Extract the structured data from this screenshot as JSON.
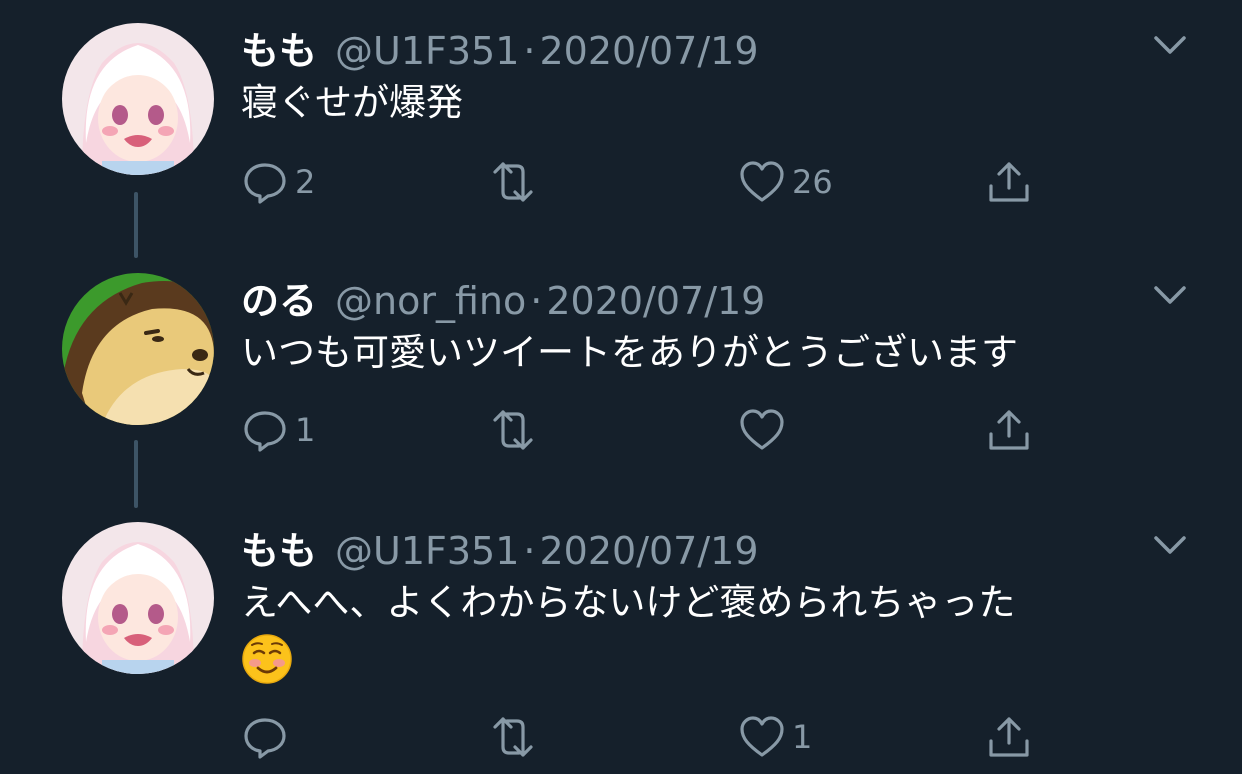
{
  "tweets": [
    {
      "name": "もも",
      "handle": "@U1F351",
      "sep": "·",
      "date": "2020/07/19",
      "text": "寝ぐせが爆発",
      "replies": "2",
      "retweets": "",
      "likes": "26",
      "avatar": "anime-girl-avatar"
    },
    {
      "name": "のる",
      "handle": "@nor_fino",
      "sep": "·",
      "date": "2020/07/19",
      "text": "いつも可愛いツイートをありがとうございます",
      "replies": "1",
      "retweets": "",
      "likes": "",
      "avatar": "hamster-avatar"
    },
    {
      "name": "もも",
      "handle": "@U1F351",
      "sep": "·",
      "date": "2020/07/19",
      "text": "えへへ、よくわからないけど褒められちゃった",
      "emoji": "smiling-face-emoji",
      "replies": "",
      "retweets": "",
      "likes": "1",
      "avatar": "anime-girl-avatar"
    }
  ],
  "colors": {
    "background": "#15202b",
    "secondary_text": "#8899a6",
    "connector": "#3d5466"
  }
}
